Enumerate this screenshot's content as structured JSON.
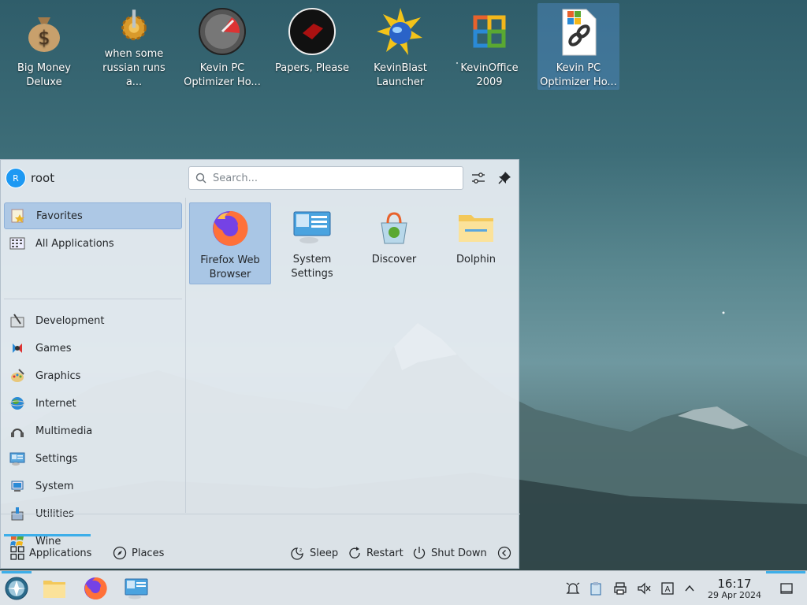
{
  "desktop": {
    "icons": [
      {
        "label": "Big Money Deluxe",
        "icon": "money-bag-icon"
      },
      {
        "label": "when some russian runs a...",
        "icon": "gear-icon"
      },
      {
        "label": "Kevin PC Optimizer Ho...",
        "icon": "gauge-icon"
      },
      {
        "label": "Papers, Please",
        "icon": "papers-please-icon"
      },
      {
        "label": "KevinBlast Launcher",
        "icon": "globe-burst-icon"
      },
      {
        "label": "KevinOffice 2009",
        "icon": "office-logo-icon"
      },
      {
        "label": "Kevin PC Optimizer Ho...",
        "icon": "link-file-icon"
      }
    ]
  },
  "menu": {
    "user": {
      "initial": "R",
      "name": "root"
    },
    "search": {
      "placeholder": "Search..."
    },
    "categories": [
      {
        "label": "Favorites",
        "icon": "favorites-icon"
      },
      {
        "label": "All Applications",
        "icon": "grid-icon"
      },
      {
        "label": "Development",
        "icon": "development-icon"
      },
      {
        "label": "Games",
        "icon": "games-icon"
      },
      {
        "label": "Graphics",
        "icon": "graphics-icon"
      },
      {
        "label": "Internet",
        "icon": "internet-icon"
      },
      {
        "label": "Multimedia",
        "icon": "multimedia-icon"
      },
      {
        "label": "Settings",
        "icon": "settings-icon"
      },
      {
        "label": "System",
        "icon": "system-icon"
      },
      {
        "label": "Utilities",
        "icon": "utilities-icon"
      },
      {
        "label": "Wine",
        "icon": "wine-icon"
      }
    ],
    "apps": [
      {
        "label": "Firefox Web Browser",
        "icon": "firefox-icon"
      },
      {
        "label": "System Settings",
        "icon": "system-settings-icon"
      },
      {
        "label": "Discover",
        "icon": "discover-icon"
      },
      {
        "label": "Dolphin",
        "icon": "folder-icon"
      }
    ],
    "footer": {
      "applications": "Applications",
      "places": "Places",
      "sleep": "Sleep",
      "restart": "Restart",
      "shutdown": "Shut Down"
    }
  },
  "taskbar": {
    "time": "16:17",
    "date": "29 Apr 2024"
  },
  "colors": {
    "accent": "#3daee9",
    "selection": "#93b8e2"
  }
}
